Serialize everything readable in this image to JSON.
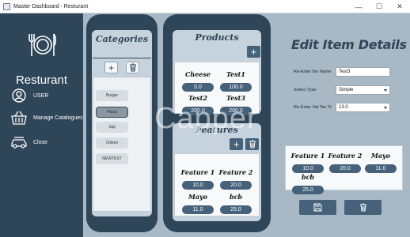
{
  "window": {
    "title": "Master Dashboard - Resturant",
    "controls": [
      "—",
      "☐",
      "✕"
    ]
  },
  "sidebar": {
    "brand": "Resturant",
    "items": [
      {
        "label": "USER",
        "icon": "user-icon"
      },
      {
        "label": "Manage Catalogues",
        "icon": "basket-icon"
      },
      {
        "label": "Close",
        "icon": "car-icon"
      }
    ]
  },
  "categories": {
    "title": "Categories",
    "items": [
      "Burger",
      "Pizza",
      "Saji",
      "Chiken",
      "NEWTEST"
    ],
    "selected_index": 1
  },
  "products": {
    "title": "Products",
    "items": [
      {
        "name": "Cheese",
        "price": "0.0"
      },
      {
        "name": "Test1",
        "price": "100.0"
      },
      {
        "name": "Test2",
        "price": "200.0"
      },
      {
        "name": "Test3",
        "price": "200.0"
      }
    ]
  },
  "features": {
    "title": "Features",
    "items": [
      {
        "name": "Feature 1",
        "price": "10.0"
      },
      {
        "name": "Feature 2",
        "price": "20.0"
      },
      {
        "name": "Mayo",
        "price": "11.0"
      },
      {
        "name": "bcb",
        "price": "25.0"
      }
    ]
  },
  "edit": {
    "title": "Edit Item Details",
    "name_label": "Re-Enter the Name",
    "name_value": "Test3",
    "type_label": "Select Type",
    "type_value": "Simple",
    "vat_label": "Re-Enter Vat Tax %",
    "vat_value": "13.0",
    "selected_features": [
      {
        "name": "Feature 1",
        "price": "10.0"
      },
      {
        "name": "Feature 2",
        "price": "20.0"
      },
      {
        "name": "Mayo",
        "price": "11.0"
      },
      {
        "name": "bcb",
        "price": "25.0"
      }
    ]
  },
  "watermark": "Capper",
  "colors": {
    "sidebar": "#2f4558",
    "content": "#a8b8c4",
    "panel_inner": "#c6d3dd",
    "price_pill": "#46627a"
  }
}
